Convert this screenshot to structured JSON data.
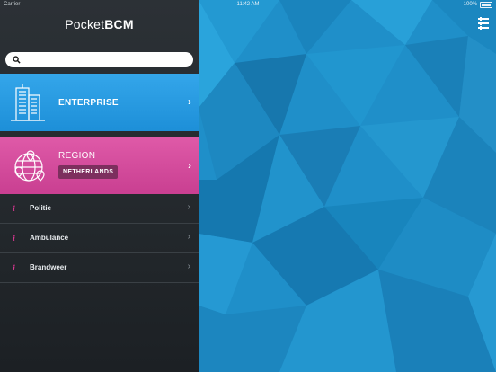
{
  "status_bar": {
    "carrier": "Carrier",
    "time": "11:42 AM",
    "battery": "100%"
  },
  "app": {
    "brand_light": "Pocket",
    "brand_bold": "BCM"
  },
  "search": {
    "placeholder": "",
    "value": ""
  },
  "enterprise": {
    "label": "ENTERPRISE",
    "icon": "building-icon",
    "color": "#2a9ae2"
  },
  "region": {
    "label": "REGION",
    "value": "NETHERLANDS",
    "icon": "globe-pins-icon",
    "color": "#d44e9d"
  },
  "items": [
    {
      "label": "Politie",
      "icon": "info-icon"
    },
    {
      "label": "Ambulance",
      "icon": "info-icon"
    },
    {
      "label": "Brandweer",
      "icon": "info-icon"
    }
  ],
  "colors": {
    "background_accent": "#1e8fc8",
    "info_accent": "#d4378f"
  }
}
